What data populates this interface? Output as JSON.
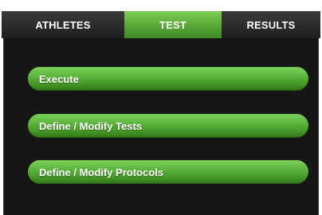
{
  "tabs": {
    "athletes": "ATHLETES",
    "test": "TEST",
    "results": "RESULTS",
    "active": "TEST"
  },
  "actions": {
    "execute": "Execute",
    "define_tests": "Define / Modify Tests",
    "define_protocols": "Define / Modify Protocols"
  },
  "colors": {
    "accent_green": "#5cb43c",
    "panel_background": "#161616",
    "tabbar_background": "#2a2a2a"
  }
}
